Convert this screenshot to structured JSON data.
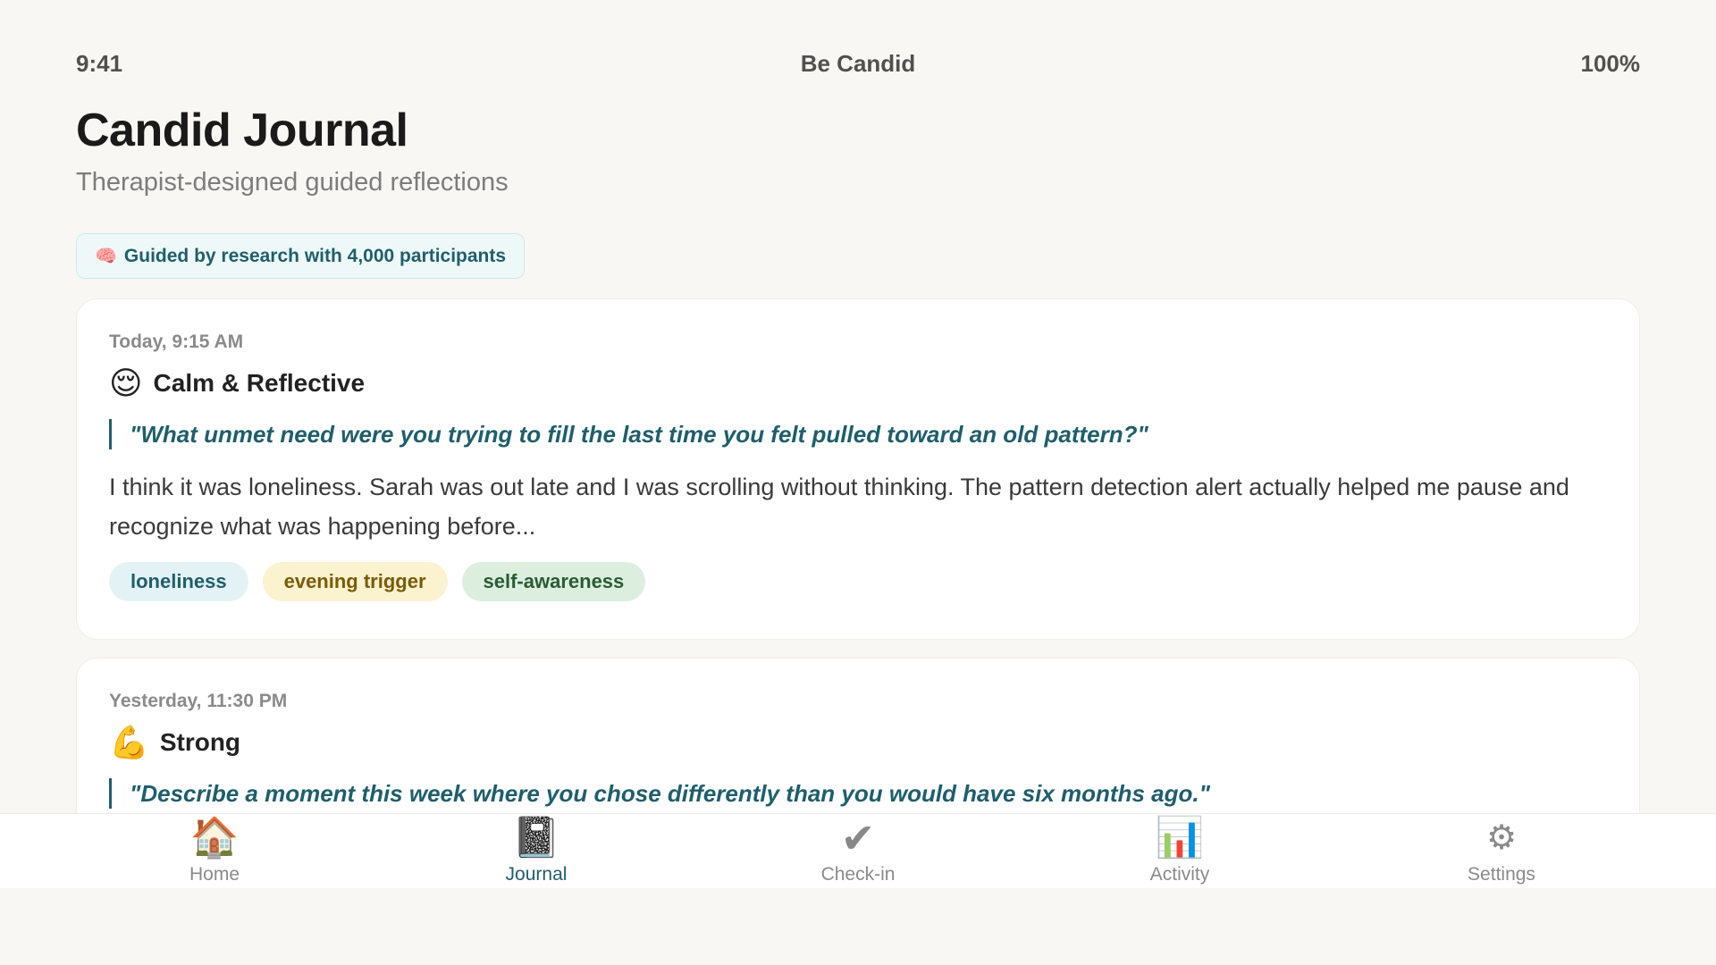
{
  "status_bar": {
    "time": "9:41",
    "app_name": "Be Candid",
    "battery": "100%"
  },
  "header": {
    "title": "Candid Journal",
    "subtitle": "Therapist-designed guided reflections"
  },
  "badge": {
    "icon": "brain-icon",
    "text": "Guided by research with 4,000 participants"
  },
  "entries": [
    {
      "time": "Today, 9:15 AM",
      "mood_icon": "😌",
      "mood": "Calm & Reflective",
      "prompt": "\"What unmet need were you trying to fill the last time you felt pulled toward an old pattern?\"",
      "body": "I think it was loneliness. Sarah was out late and I was scrolling without thinking. The pattern detection alert actually helped me pause and recognize what was happening before...",
      "tags": [
        {
          "label": "loneliness",
          "color": "#e3f3f5"
        },
        {
          "label": "evening trigger",
          "color": "#fbf2cf"
        },
        {
          "label": "self-awareness",
          "color": "#dcefdf"
        }
      ]
    },
    {
      "time": "Yesterday, 11:30 PM",
      "mood_icon": "💪",
      "mood": "Strong",
      "prompt": "\"Describe a moment this week where you chose differently than you would have six months ago.\""
    }
  ],
  "tab_bar": {
    "active": "Journal",
    "accent_color": "#1f5e6c",
    "tabs": [
      {
        "icon": "home-icon",
        "glyph": "🏠",
        "label": "Home"
      },
      {
        "icon": "journal-icon",
        "glyph": "📓",
        "label": "Journal"
      },
      {
        "icon": "checkmark-icon",
        "glyph": "✔",
        "label": "Check-in"
      },
      {
        "icon": "bar-chart-icon",
        "glyph": "📊",
        "label": "Activity"
      },
      {
        "icon": "gear-icon",
        "glyph": "⚙",
        "label": "Settings"
      }
    ]
  }
}
